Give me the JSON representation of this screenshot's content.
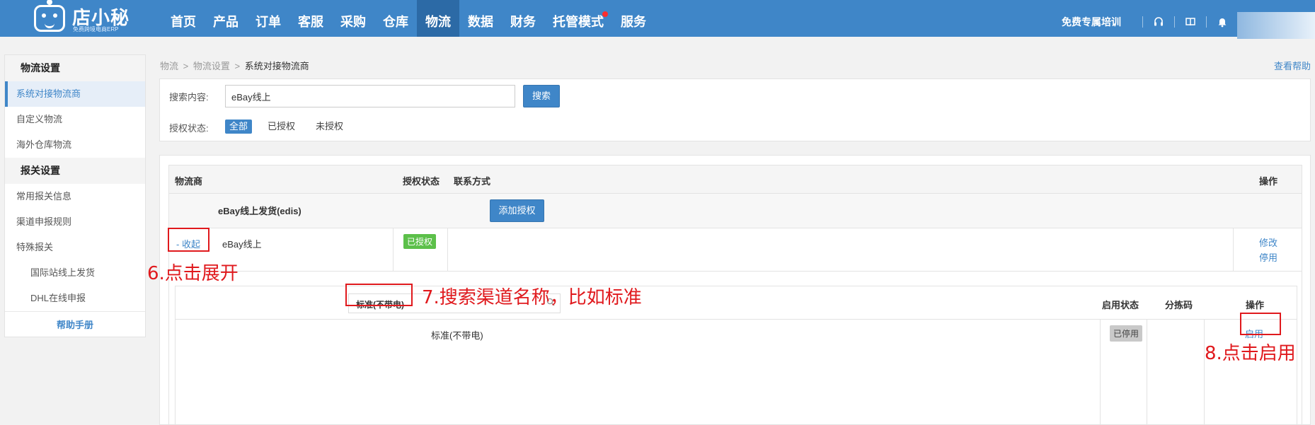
{
  "brand": {
    "name": "店小秘",
    "tagline": "免费跨境电商ERP"
  },
  "nav": {
    "items": [
      {
        "label": "首页",
        "active": false,
        "dot": false
      },
      {
        "label": "产品",
        "active": false,
        "dot": false
      },
      {
        "label": "订单",
        "active": false,
        "dot": false
      },
      {
        "label": "客服",
        "active": false,
        "dot": false
      },
      {
        "label": "采购",
        "active": false,
        "dot": false
      },
      {
        "label": "仓库",
        "active": false,
        "dot": false
      },
      {
        "label": "物流",
        "active": true,
        "dot": false
      },
      {
        "label": "数据",
        "active": false,
        "dot": false
      },
      {
        "label": "财务",
        "active": false,
        "dot": false
      },
      {
        "label": "托管模式",
        "active": false,
        "dot": true
      },
      {
        "label": "服务",
        "active": false,
        "dot": false
      }
    ],
    "right_link": "免费专属培训",
    "icons": [
      "headset-icon",
      "book-icon",
      "bell-icon"
    ]
  },
  "sidebar": {
    "group1": "物流设置",
    "items1": [
      "系统对接物流商",
      "自定义物流",
      "海外仓库物流"
    ],
    "group2": "报关设置",
    "items2": [
      "常用报关信息",
      "渠道申报规则",
      "特殊报关"
    ],
    "subitems": [
      "国际站线上发货",
      "DHL在线申报"
    ],
    "help": "帮助手册"
  },
  "breadcrumb": {
    "level1": "物流",
    "level2": "物流设置",
    "current": "系统对接物流商",
    "sep": ">"
  },
  "help_link": "查看帮助",
  "search": {
    "label": "搜索内容:",
    "value": "eBay线上",
    "button": "搜索",
    "status_label": "授权状态:",
    "filters": [
      "全部",
      "已授权",
      "未授权"
    ]
  },
  "table": {
    "headers": {
      "carrier": "物流商",
      "auth_status": "授权状态",
      "contact": "联系方式",
      "ops": "操作"
    },
    "group_name": "eBay线上发货(edis)",
    "add_auth": "添加授权",
    "row": {
      "toggle": "- 收起",
      "name": "eBay线上",
      "status": "已授权",
      "op_edit": "修改",
      "op_disable": "停用"
    },
    "sub": {
      "search_value": "标准(不带电)",
      "headers": {
        "enable_status": "启用状态",
        "sort_code": "分拣码",
        "ops": "操作"
      },
      "channel": "标准(不带电)",
      "status": "已停用",
      "op_enable": "启用"
    }
  },
  "annotations": {
    "step6": "6.点击展开",
    "step7": "7.搜索渠道名称，比如标准",
    "step8": "8.点击启用",
    "color": "#e0191d"
  }
}
